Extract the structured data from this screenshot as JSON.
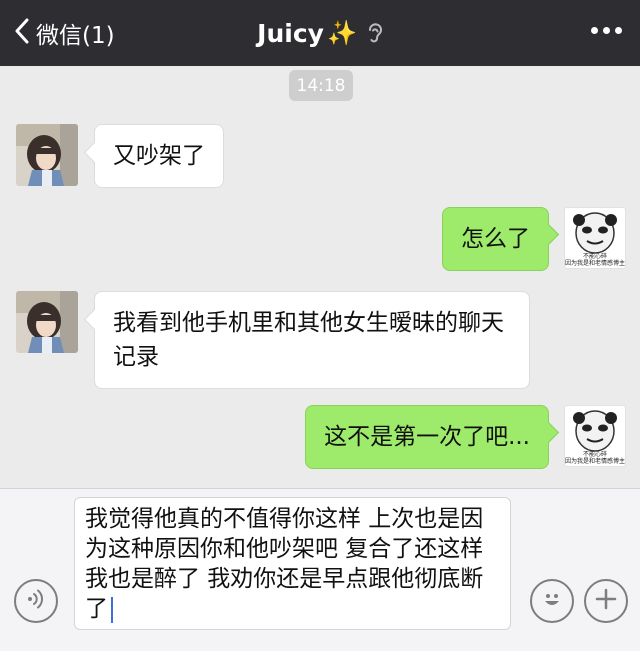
{
  "nav": {
    "back_label": "微信(1)",
    "title": "Juicy",
    "title_emoji": "✨",
    "more_icon": "more-dots-icon",
    "earpiece_icon": "ear-icon"
  },
  "timestamp": "14:18",
  "messages": [
    {
      "side": "left",
      "text": "又吵架了"
    },
    {
      "side": "right",
      "text": "怎么了"
    },
    {
      "side": "left",
      "text": "我看到他手机里和其他女生暧昧的聊天记录"
    },
    {
      "side": "right",
      "text": "这不是第一次了吧..."
    }
  ],
  "sticker": {
    "line1": "不能心碎",
    "line2": "因为我是和老情感博主"
  },
  "input": {
    "text": "我觉得他真的不值得你这样 上次也是因为这种原因你和他吵架吧 复合了还这样我也是醉了 我劝你还是早点跟他彻底断了"
  },
  "colors": {
    "nav_bg": "#2e2e32",
    "chat_bg": "#ebebeb",
    "outgoing_bubble": "#9eea6a",
    "incoming_bubble": "#ffffff"
  }
}
